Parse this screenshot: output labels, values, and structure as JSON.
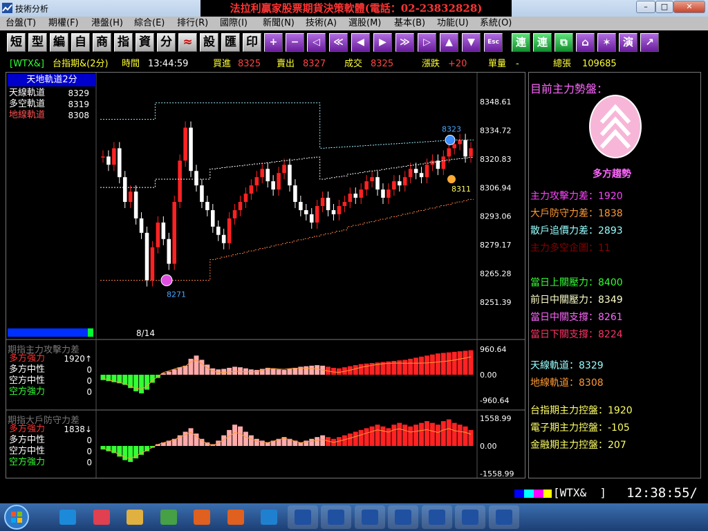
{
  "window": {
    "title": "技術分析",
    "brand": "法拉利贏家股票期貨決策軟體(電話：02-23832828)",
    "min": "–",
    "max": "□",
    "close": "✕"
  },
  "menu": [
    "台盤(T)",
    "期權(F)",
    "港盤(H)",
    "綜合(E)",
    "排行(R)",
    "國際(I)",
    "新聞(N)",
    "技術(A)",
    "選股(M)",
    "基本(B)",
    "功能(U)",
    "系統(O)"
  ],
  "toolbar": {
    "chars": [
      "短",
      "型",
      "編",
      "自",
      "商",
      "指",
      "資",
      "分"
    ],
    "chars2": [
      "設",
      "匯",
      "印"
    ],
    "plus": "+",
    "minus": "−",
    "arrows": [
      "◁",
      "≪",
      "◀",
      "▶",
      "≫",
      "▷",
      "▲",
      "▼"
    ],
    "esc": "Esc",
    "right": [
      "連",
      "連",
      "⧉",
      "⌂",
      "✶",
      "演",
      "↗"
    ]
  },
  "quote": {
    "symbol": "[WTX&]",
    "name": "台指期&(2分)",
    "time_label": "時間",
    "time": "13:44:59",
    "bid_label": "買進",
    "bid": "8325",
    "ask_label": "賣出",
    "ask": "8327",
    "last_label": "成交",
    "last": "8325",
    "change_label": "漲跌",
    "change": "+20",
    "vol_label": "單量",
    "vol": "-",
    "total_label": "總張",
    "total": "109685"
  },
  "main_chart": {
    "legend_title": "天地軌道2分",
    "lines": [
      {
        "label": "天線軌道",
        "value": "8329",
        "color": "#ffffff"
      },
      {
        "label": "多空軌道",
        "value": "8319",
        "color": "#ffffff"
      },
      {
        "label": "地線軌道",
        "value": "8308",
        "color": "#ff5050"
      }
    ],
    "date_label": "8/14",
    "marker_high": "8323",
    "marker_mid": "8311",
    "marker_low": "8271",
    "colors": {
      "up": "#ff2222",
      "down": "#ffffff",
      "upper": "#9ff0ff",
      "lower": "#ff8040",
      "mid": "#ffffff"
    }
  },
  "chart_data": [
    {
      "type": "bar",
      "title": "",
      "ylim": [
        8240,
        8360
      ],
      "y_ticks": [
        "8348.61",
        "8334.72",
        "8320.83",
        "8306.94",
        "8293.06",
        "8279.17",
        "8265.28",
        "8251.39"
      ],
      "x": [
        "8/14"
      ],
      "closes": [
        8322,
        8318,
        8326,
        8312,
        8300,
        8305,
        8292,
        8285,
        8262,
        8278,
        8290,
        8282,
        8270,
        8300,
        8320,
        8336,
        8315,
        8308,
        8300,
        8296,
        8288,
        8284,
        8280,
        8292,
        8296,
        8300,
        8304,
        8308,
        8312,
        8316,
        8310,
        8306,
        8314,
        8318,
        8308,
        8300,
        8296,
        8294,
        8290,
        8298,
        8302,
        8296,
        8294,
        8298,
        8300,
        8304,
        8302,
        8306,
        8310,
        8312,
        8306,
        8302,
        8306,
        8310,
        8308,
        8312,
        8316,
        8314,
        8312,
        8318,
        8320,
        8316,
        8322,
        8326,
        8328,
        8330,
        8322,
        8326
      ]
    },
    {
      "type": "bar",
      "title": "期指主力攻擊力差",
      "y_ticks": [
        "960.64",
        "0.00",
        "-960.64"
      ],
      "ylim": [
        -960.64,
        960.64
      ],
      "values": [
        -200,
        -240,
        -280,
        -320,
        -380,
        -500,
        -620,
        -700,
        -560,
        -300,
        -120,
        60,
        120,
        200,
        280,
        340,
        600,
        720,
        560,
        380,
        240,
        200,
        220,
        260,
        300,
        280,
        240,
        200,
        180,
        220,
        260,
        240,
        200,
        180,
        220,
        260,
        300,
        320,
        340,
        360,
        340,
        300,
        260,
        240,
        280,
        320,
        360,
        400,
        420,
        440,
        460,
        480,
        500,
        520,
        540,
        560,
        600,
        640,
        680,
        720,
        760,
        800,
        820,
        840,
        860,
        880,
        900,
        920
      ]
    },
    {
      "type": "bar",
      "title": "期指大戶防守力差",
      "y_ticks": [
        "1558.99",
        "0.00",
        "-1558.99"
      ],
      "ylim": [
        -1558.99,
        1558.99
      ],
      "values": [
        -200,
        -300,
        -400,
        -600,
        -800,
        -900,
        -700,
        -500,
        -300,
        -100,
        100,
        200,
        300,
        400,
        600,
        800,
        1000,
        700,
        400,
        200,
        100,
        300,
        600,
        900,
        1200,
        1100,
        800,
        600,
        400,
        300,
        200,
        300,
        400,
        500,
        400,
        300,
        200,
        300,
        400,
        500,
        600,
        500,
        400,
        500,
        600,
        700,
        800,
        900,
        1000,
        1100,
        1200,
        1100,
        1000,
        1200,
        1300,
        1200,
        1100,
        1200,
        1300,
        1400,
        1300,
        1200,
        1400,
        1500,
        1300,
        1200,
        1100,
        900
      ]
    }
  ],
  "sub1": {
    "title": "期指主力攻擊力差",
    "rows": [
      {
        "label": "多方強力",
        "value": "1920↑",
        "color": "#ff3333"
      },
      {
        "label": "多方中性",
        "value": "0",
        "color": "#ffffff"
      },
      {
        "label": "空方中性",
        "value": "0",
        "color": "#ffffff"
      },
      {
        "label": "空方強力",
        "value": "0",
        "color": "#33ff33"
      }
    ]
  },
  "sub2": {
    "title": "期指大戶防守力差",
    "rows": [
      {
        "label": "多方強力",
        "value": "1838↓",
        "color": "#ff3333"
      },
      {
        "label": "多方中性",
        "value": "0",
        "color": "#ffffff"
      },
      {
        "label": "空方中性",
        "value": "0",
        "color": "#ffffff"
      },
      {
        "label": "空方強力",
        "value": "0",
        "color": "#33ff33"
      }
    ]
  },
  "right_panel": {
    "heading": "目前主力勢盤：",
    "trend_label": "多方趨勢",
    "items": [
      {
        "label": "主力攻擊力差：",
        "value": "1920",
        "color": "#ff44ff"
      },
      {
        "label": "大戶防守力差：",
        "value": "1838",
        "color": "#ff9933"
      },
      {
        "label": "散戶追價力差：",
        "value": "2893",
        "color": "#99ffff"
      },
      {
        "label": "主力多空企圖：",
        "value": "11",
        "color": "#880000"
      },
      {
        "label": "當日上關壓力：",
        "value": "8400",
        "color": "#33ff33"
      },
      {
        "label": "前日中關壓力：",
        "value": "8349",
        "color": "#ffffcc"
      },
      {
        "label": "當日中關支撐：",
        "value": "8261",
        "color": "#ff66ff"
      },
      {
        "label": "當日下關支撐：",
        "value": "8224",
        "color": "#ff3366"
      },
      {
        "label": "天線軌道：",
        "value": "8329",
        "color": "#99ffff"
      },
      {
        "label": "地線軌道：",
        "value": "8308",
        "color": "#ff9933"
      },
      {
        "label": "台指期主力控盤：",
        "value": "1920",
        "color": "#ffff66"
      },
      {
        "label": "電子期主力控盤：",
        "value": "-105",
        "color": "#ffff66"
      },
      {
        "label": "金融期主力控盤：",
        "value": "207",
        "color": "#ffff66"
      }
    ]
  },
  "status": {
    "symbol": "[WTX&  ]",
    "clock": "12:38:55/"
  }
}
